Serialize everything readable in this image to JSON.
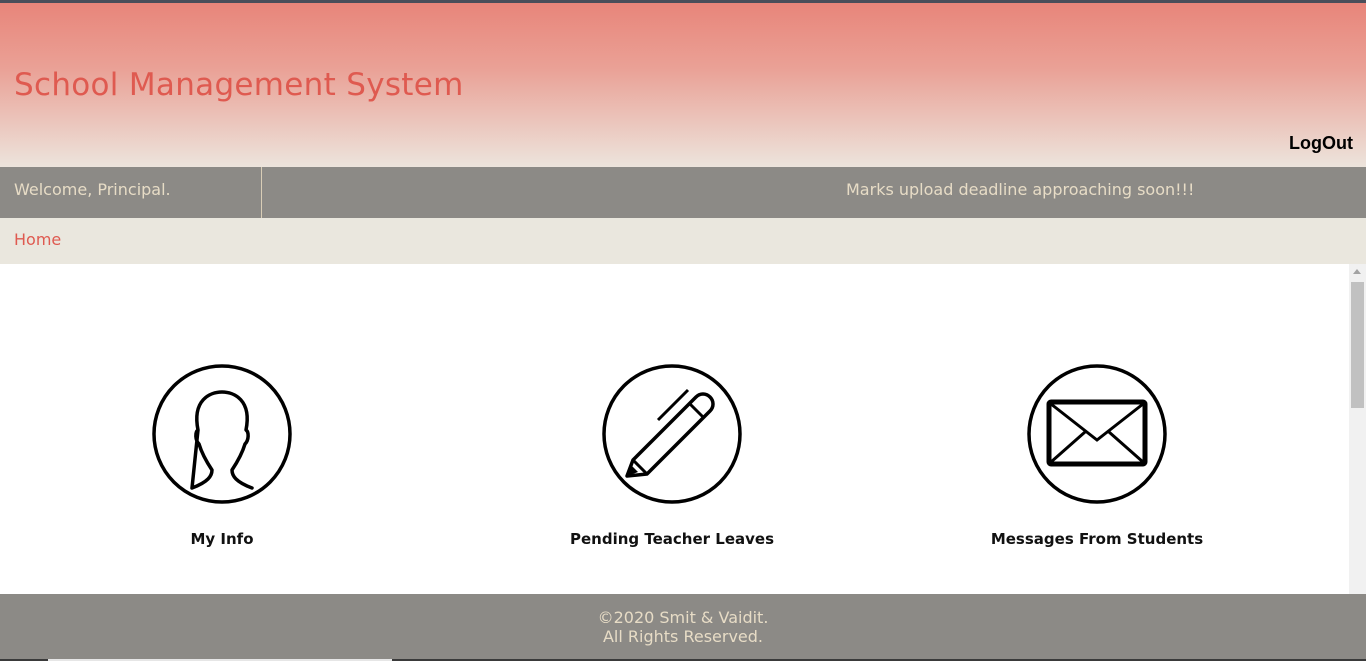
{
  "header": {
    "title": "School Management System",
    "logout_label": "LogOut"
  },
  "statusbar": {
    "welcome": "Welcome, Principal.",
    "announcement": "Marks upload deadline approaching soon!!!"
  },
  "breadcrumb": {
    "home": "Home"
  },
  "cards": [
    {
      "label": "My Info",
      "icon": "user-icon"
    },
    {
      "label": "Pending Teacher Leaves",
      "icon": "pen-icon"
    },
    {
      "label": "Messages From Students",
      "icon": "envelope-icon"
    }
  ],
  "footer": {
    "line1": "©2020 Smit & Vaidit.",
    "line2": "All Rights Reserved."
  },
  "colors": {
    "accent": "#df5a50",
    "bar": "#8c8a86",
    "bar_text": "#e7dcc6",
    "breadcrumb_bg": "#eae7de"
  }
}
